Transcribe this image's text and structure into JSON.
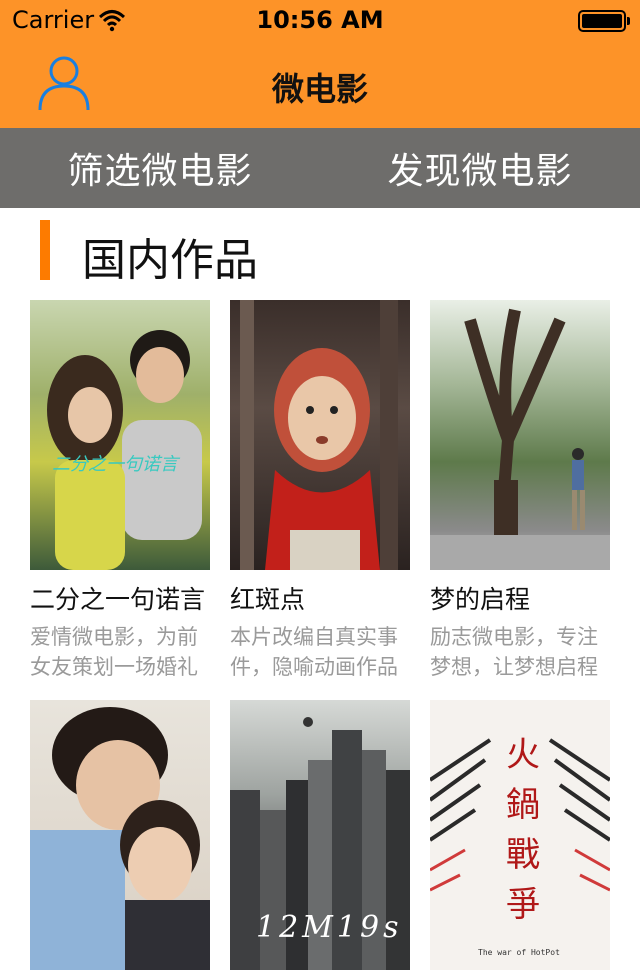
{
  "status_bar": {
    "carrier": "Carrier",
    "time": "10:56 AM"
  },
  "nav": {
    "title": "微电影",
    "user_icon": "user-icon"
  },
  "segments": [
    {
      "label": "筛选微电影"
    },
    {
      "label": "发现微电影"
    }
  ],
  "section": {
    "title": "国内作品"
  },
  "movies": [
    {
      "title": "二分之一句诺言",
      "desc": "爱情微电影，为前女友策划一场婚礼",
      "poster_text": "二分之一句诺言"
    },
    {
      "title": "红斑点",
      "desc": "本片改编自真实事件，隐喻动画作品"
    },
    {
      "title": "梦的启程",
      "desc": "励志微电影，专注梦想，让梦想启程"
    },
    {
      "title": "",
      "desc": ""
    },
    {
      "title": "",
      "desc": "",
      "poster_text": "12M19s"
    },
    {
      "title": "",
      "desc": "",
      "poster_text": "火鍋戰爭",
      "poster_subtext": "The war of HotPot"
    }
  ],
  "colors": {
    "nav_bg": "#fd9328",
    "segment_bg": "#6e6d6b",
    "accent": "#fd7b00"
  }
}
